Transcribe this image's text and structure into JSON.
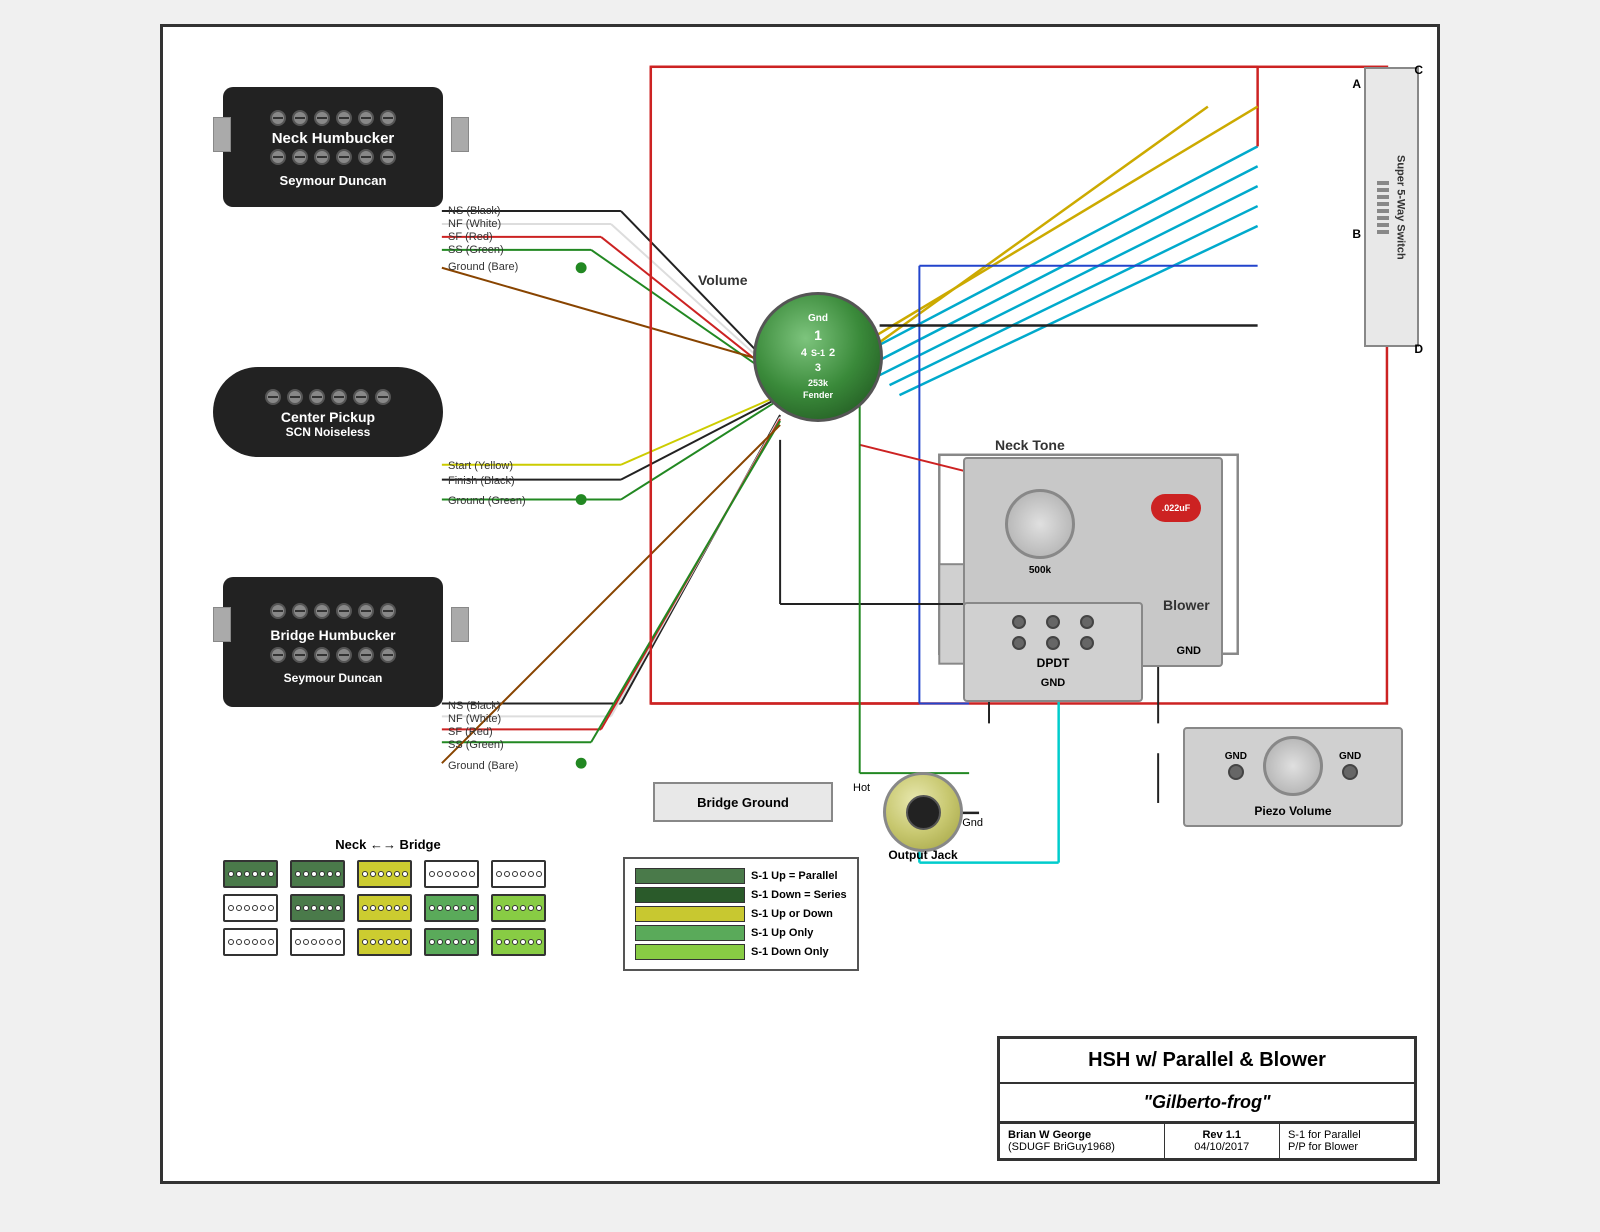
{
  "diagram": {
    "title": "HSH w/ Parallel & Blower",
    "subtitle": "\"Gilberto-frog\"",
    "author": "Brian W George",
    "author_alias": "(SDUGF BriGuy1968)",
    "rev": "Rev 1.1",
    "date": "04/10/2017",
    "note1": "S-1 for Parallel",
    "note2": "P/P for Blower"
  },
  "components": {
    "neck_pickup": {
      "label": "Neck Humbucker",
      "brand": "Seymour Duncan",
      "wires": [
        "NS (Black)",
        "NF (White)",
        "SF (Red)",
        "SS (Green)",
        "Ground (Bare)"
      ]
    },
    "center_pickup": {
      "label": "Center Pickup",
      "brand": "SCN Noiseless",
      "wires": [
        "Start (Yellow)",
        "Finish (Black)",
        "Ground (Green)"
      ]
    },
    "bridge_pickup": {
      "label": "Bridge Humbucker",
      "brand": "Seymour Duncan",
      "wires": [
        "NS (Black)",
        "NF (White)",
        "SF (Red)",
        "SS (Green)",
        "Ground (Bare)"
      ]
    },
    "volume": "Volume",
    "neck_tone": "Neck Tone",
    "switch_label": "Super 5-Way Switch",
    "output_jack_label": "Output Jack",
    "bridge_ground_label": "Bridge Ground",
    "dpdt_label": "DPDT",
    "blower_label": "Blower",
    "piezo_label": "Piezo Volume"
  },
  "legend": {
    "neck_bridge_label": "Neck ←→ Bridge",
    "items": [
      {
        "label": "S-1 Up = Parallel",
        "color": "#4a7a4a"
      },
      {
        "label": "S-1 Down = Series",
        "color": "#2a5a2a"
      },
      {
        "label": "S-1 Up or Down",
        "color": "#c8c830"
      },
      {
        "label": "S-1 Up Only",
        "color": "#5aaa5a"
      },
      {
        "label": "S-1 Down Only",
        "color": "#88cc44"
      }
    ]
  },
  "pot_labels": {
    "gnd": "Gnd",
    "s1": "S-1",
    "value": "253k",
    "fender": "Fender"
  }
}
